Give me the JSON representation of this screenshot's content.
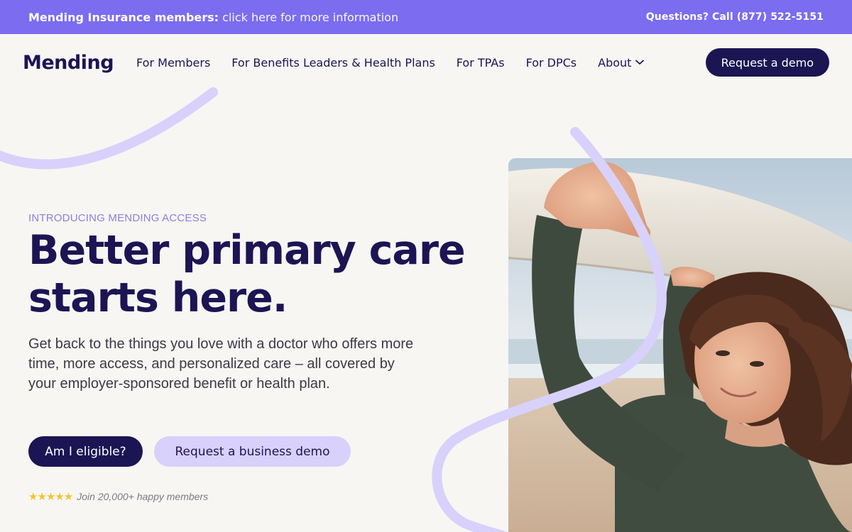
{
  "announcement": {
    "lead": "Mending Insurance members:",
    "link": "click here for more information",
    "questions_label": "Questions? Call",
    "phone": "(877) 522-5151"
  },
  "nav": {
    "logo": "Mending",
    "items": [
      "For Members",
      "For Benefits Leaders & Health Plans",
      "For TPAs",
      "For DPCs",
      "About"
    ],
    "cta": "Request a demo"
  },
  "hero": {
    "eyebrow": "INTRODUCING MENDING ACCESS",
    "headline_line1": "Better primary care",
    "headline_line2": "starts here.",
    "subtext": "Get back to the things you love with a doctor who offers more time, more access, and personalized care – all covered by your employer-sponsored benefit or health plan.",
    "primary_button": "Am I eligible?",
    "secondary_button": "Request a business demo",
    "stars": "★★★★★",
    "rating": 5,
    "social_proof": "Join 20,000+ happy members"
  },
  "colors": {
    "brand_purple": "#7b6cf0",
    "navy": "#1c1553",
    "lavender": "#d8d1fb",
    "background": "#f7f6f3"
  }
}
